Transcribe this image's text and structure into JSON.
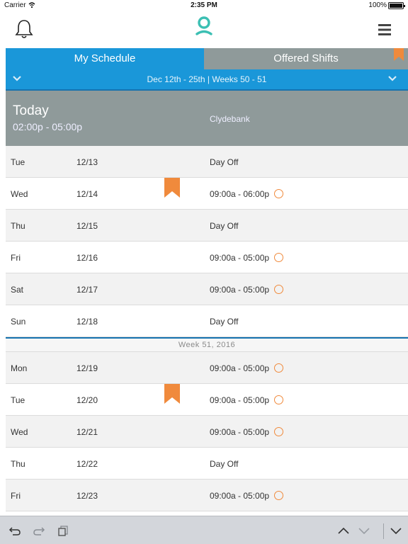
{
  "status_bar": {
    "carrier": "Carrier",
    "time": "2:35 PM",
    "battery": "100%"
  },
  "tabs": [
    {
      "label": "My Schedule",
      "active": true
    },
    {
      "label": "Offered Shifts",
      "active": false
    }
  ],
  "week_range": "Dec 12th - 25th | Weeks 50 - 51",
  "today": {
    "label": "Today",
    "hours": "02:00p - 05:00p",
    "location": "Clydebank"
  },
  "week1_rows": [
    {
      "day": "Tue",
      "date": "12/13",
      "shift": "Day Off"
    },
    {
      "day": "Wed",
      "date": "12/14",
      "shift": "09:00a - 06:00p"
    },
    {
      "day": "Thu",
      "date": "12/15",
      "shift": "Day Off"
    },
    {
      "day": "Fri",
      "date": "12/16",
      "shift": "09:00a - 05:00p"
    },
    {
      "day": "Sat",
      "date": "12/17",
      "shift": "09:00a - 05:00p"
    },
    {
      "day": "Sun",
      "date": "12/18",
      "shift": "Day Off"
    }
  ],
  "week_separator": "Week 51, 2016",
  "week2_rows": [
    {
      "day": "Mon",
      "date": "12/19",
      "shift": "09:00a - 05:00p"
    },
    {
      "day": "Tue",
      "date": "12/20",
      "shift": "09:00a - 05:00p"
    },
    {
      "day": "Wed",
      "date": "12/21",
      "shift": "09:00a - 05:00p"
    },
    {
      "day": "Thu",
      "date": "12/22",
      "shift": "Day Off"
    },
    {
      "day": "Fri",
      "date": "12/23",
      "shift": "09:00a - 05:00p"
    }
  ],
  "colors": {
    "accent_blue": "#1a97d9",
    "header_gray": "#8f9a9a",
    "flag_orange": "#f08a3c",
    "logo_teal": "#3bbfb3"
  },
  "icons": {
    "nav": [
      "bell-icon",
      "person-logo-icon",
      "hamburger-menu-icon"
    ],
    "toolbar": [
      "undo-icon",
      "redo-icon",
      "paste-icon",
      "chevron-up-icon",
      "chevron-down-icon",
      "keyboard-hide-icon"
    ]
  }
}
